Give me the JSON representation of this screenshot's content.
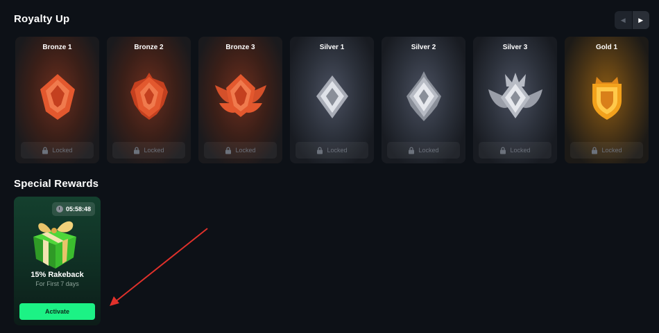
{
  "royalty": {
    "title": "Royalty Up",
    "nav_prev_icon": "chevron-left-icon",
    "nav_next_icon": "chevron-right-icon",
    "tiers": [
      {
        "name": "Bronze 1",
        "status": "Locked",
        "tier": "bronze"
      },
      {
        "name": "Bronze 2",
        "status": "Locked",
        "tier": "bronze"
      },
      {
        "name": "Bronze 3",
        "status": "Locked",
        "tier": "bronze"
      },
      {
        "name": "Silver 1",
        "status": "Locked",
        "tier": "silver"
      },
      {
        "name": "Silver 2",
        "status": "Locked",
        "tier": "silver"
      },
      {
        "name": "Silver 3",
        "status": "Locked",
        "tier": "silver"
      },
      {
        "name": "Gold 1",
        "status": "Locked",
        "tier": "gold"
      }
    ]
  },
  "special": {
    "title": "Special Rewards",
    "reward": {
      "timer": "05:58:48",
      "title": "15% Rakeback",
      "subtitle": "For First 7 days",
      "button_label": "Activate",
      "icon": "gift-box-icon"
    }
  },
  "colors": {
    "background": "#0d1117",
    "accent_green": "#1cf285",
    "bronze": "#e3582e",
    "silver": "#c9ccd4",
    "gold": "#f2a11c",
    "annotation_red": "#e0312b"
  }
}
